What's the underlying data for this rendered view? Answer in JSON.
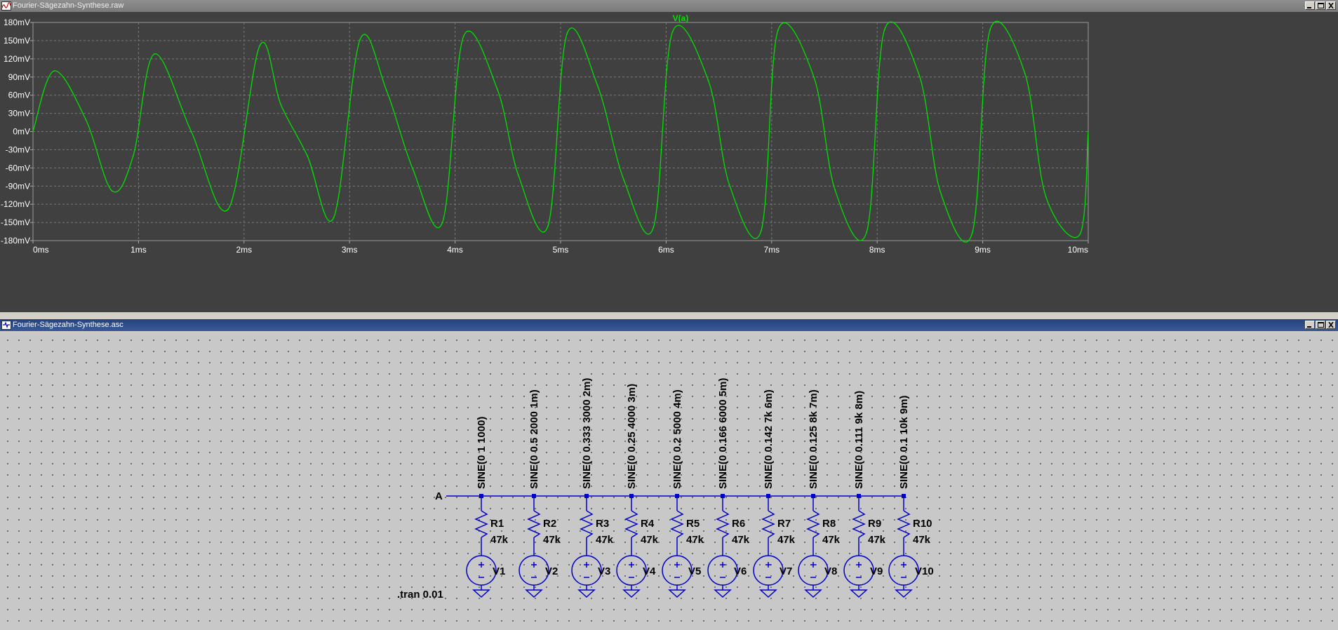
{
  "waveform_window": {
    "title": "Fourier-Sägezahn-Synthese.raw",
    "trace_label": "V(a)",
    "colors": {
      "background": "#404040",
      "trace": "#00e000",
      "grid": "#7a7a7a",
      "text": "#ffffff"
    }
  },
  "schematic_window": {
    "title": "Fourier-Sägezahn-Synthese.asc",
    "colors": {
      "wire": "#0000c8",
      "background": "#c8c8c8",
      "text": "#000000"
    }
  },
  "chart_data": {
    "type": "line",
    "title": "V(a)",
    "xlabel": "",
    "ylabel": "",
    "x_ticks": [
      "0ms",
      "1ms",
      "2ms",
      "3ms",
      "4ms",
      "5ms",
      "6ms",
      "7ms",
      "8ms",
      "9ms",
      "10ms"
    ],
    "y_ticks": [
      "180mV",
      "150mV",
      "120mV",
      "90mV",
      "60mV",
      "30mV",
      "0mV",
      "-30mV",
      "-60mV",
      "-90mV",
      "-120mV",
      "-150mV",
      "-180mV"
    ],
    "xlim": [
      0,
      10
    ],
    "ylim": [
      -180,
      180
    ],
    "grid": true,
    "series": [
      {
        "name": "V(a)",
        "x_unit": "ms",
        "y_unit": "mV",
        "x": [
          0,
          0.2,
          0.5,
          0.75,
          0.95,
          1.15,
          1.5,
          1.85,
          2.15,
          2.35,
          2.6,
          2.85,
          3.1,
          3.35,
          3.6,
          3.88,
          4.08,
          4.4,
          4.6,
          4.88,
          5.06,
          5.35,
          5.6,
          5.88,
          6.06,
          6.4,
          6.6,
          6.9,
          7.06,
          7.4,
          7.6,
          7.9,
          8.07,
          8.4,
          8.6,
          8.9,
          9.07,
          9.4,
          9.6,
          9.92,
          10.0
        ],
        "y": [
          0,
          100,
          20,
          -98,
          -40,
          128,
          0,
          -128,
          142,
          44,
          -40,
          -142,
          152,
          68,
          -62,
          -150,
          157,
          70,
          -72,
          -156,
          161,
          76,
          -80,
          -158,
          164,
          84,
          -88,
          -164,
          167,
          90,
          -96,
          -166,
          168,
          92,
          -100,
          -168,
          168,
          96,
          -108,
          -170,
          0
        ]
      }
    ]
  },
  "circuit": {
    "node_label": "A",
    "directive": ".tran 0.01",
    "branches": [
      {
        "resistor": "R1",
        "res_value": "47k",
        "source": "V1",
        "sine": "SINE(0 1 1000)"
      },
      {
        "resistor": "R2",
        "res_value": "47k",
        "source": "V2",
        "sine": "SINE(0 0.5 2000 1m)"
      },
      {
        "resistor": "R3",
        "res_value": "47k",
        "source": "V3",
        "sine": "SINE(0 0.333 3000 2m)"
      },
      {
        "resistor": "R4",
        "res_value": "47k",
        "source": "V4",
        "sine": "SINE(0 0.25 4000 3m)"
      },
      {
        "resistor": "R5",
        "res_value": "47k",
        "source": "V5",
        "sine": "SINE(0 0.2 5000 4m)"
      },
      {
        "resistor": "R6",
        "res_value": "47k",
        "source": "V6",
        "sine": "SINE(0 0.166 6000 5m)"
      },
      {
        "resistor": "R7",
        "res_value": "47k",
        "source": "V7",
        "sine": "SINE(0 0.142 7k 6m)"
      },
      {
        "resistor": "R8",
        "res_value": "47k",
        "source": "V8",
        "sine": "SINE(0 0.125 8k 7m)"
      },
      {
        "resistor": "R9",
        "res_value": "47k",
        "source": "V9",
        "sine": "SINE(0 0.111 9k 8m)"
      },
      {
        "resistor": "R10",
        "res_value": "47k",
        "source": "V10",
        "sine": "SINE(0 0.1 10k 9m)"
      }
    ]
  }
}
